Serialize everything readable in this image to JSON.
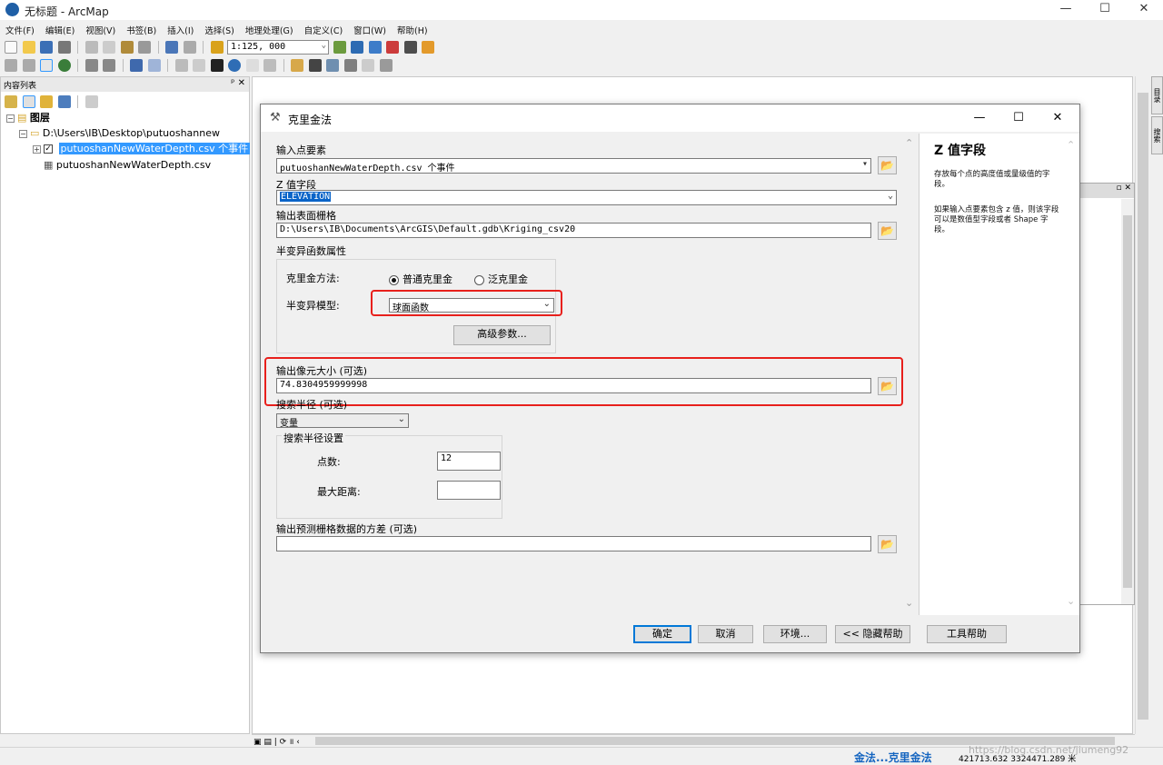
{
  "window": {
    "title": "无标题 - ArcMap",
    "minimize": "—",
    "maximize": "☐",
    "close": "✕"
  },
  "menu": [
    "文件(F)",
    "编辑(E)",
    "视图(V)",
    "书签(B)",
    "插入(I)",
    "选择(S)",
    "地理处理(G)",
    "自定义(C)",
    "窗口(W)",
    "帮助(H)"
  ],
  "toolbar": {
    "scale": "1:125, 000"
  },
  "toc": {
    "title": "内容列表",
    "pin": "ᵖ ✕",
    "root": "图层",
    "folder": "D:\\Users\\IB\\Desktop\\putuoshannew",
    "layer_event": "putuoshanNewWaterDepth.csv 个事件",
    "layer_table": "putuoshanNewWaterDepth.csv"
  },
  "dialog": {
    "title": "克里金法",
    "input_points_label": "输入点要素",
    "input_points_value": "putuoshanNewWaterDepth.csv 个事件",
    "z_field_label": "Z 值字段",
    "z_field_value": "ELEVATION",
    "output_raster_label": "输出表面栅格",
    "output_raster_value": "D:\\Users\\IB\\Documents\\ArcGIS\\Default.gdb\\Kriging_csv20",
    "semivariogram_label": "半变异函数属性",
    "kriging_method_label": "克里金方法:",
    "method_ordinary": "普通克里金",
    "method_universal": "泛克里金",
    "semivariogram_model_label": "半变异模型:",
    "semivariogram_model_value": "球面函数",
    "advanced_button": "高级参数...",
    "cell_size_label": "输出像元大小 (可选)",
    "cell_size_value": "74.8304959999998",
    "search_radius_label": "搜索半径 (可选)",
    "search_radius_value": "变量",
    "search_settings_label": "搜索半径设置",
    "num_points_label": "点数:",
    "num_points_value": "12",
    "max_distance_label": "最大距离:",
    "max_distance_value": "",
    "variance_label": "输出预测栅格数据的方差 (可选)",
    "variance_value": "",
    "ok_button": "确定",
    "cancel_button": "取消",
    "env_button": "环境...",
    "hide_help_button": "<< 隐藏帮助",
    "tool_help_button": "工具帮助"
  },
  "help": {
    "title": "Z 值字段",
    "para1": "存放每个点的高度值或量级值的字段。",
    "para2": "如果输入点要素包含 z 值，则该字段可以是数值型字段或者 Shape 字段。"
  },
  "right_rail": {
    "tab1": "目录",
    "tab2": "搜索"
  },
  "status": {
    "tool_name": "金法...克里金法",
    "coords": "421713.632  3324471.289 米",
    "watermark": "https://blog.csdn.net/jiumeng92"
  },
  "colors": {
    "highlight_frame": "#e8201c",
    "selection": "#3399ff",
    "primary_button": "#0078d7",
    "status_blue": "#1565c0"
  }
}
